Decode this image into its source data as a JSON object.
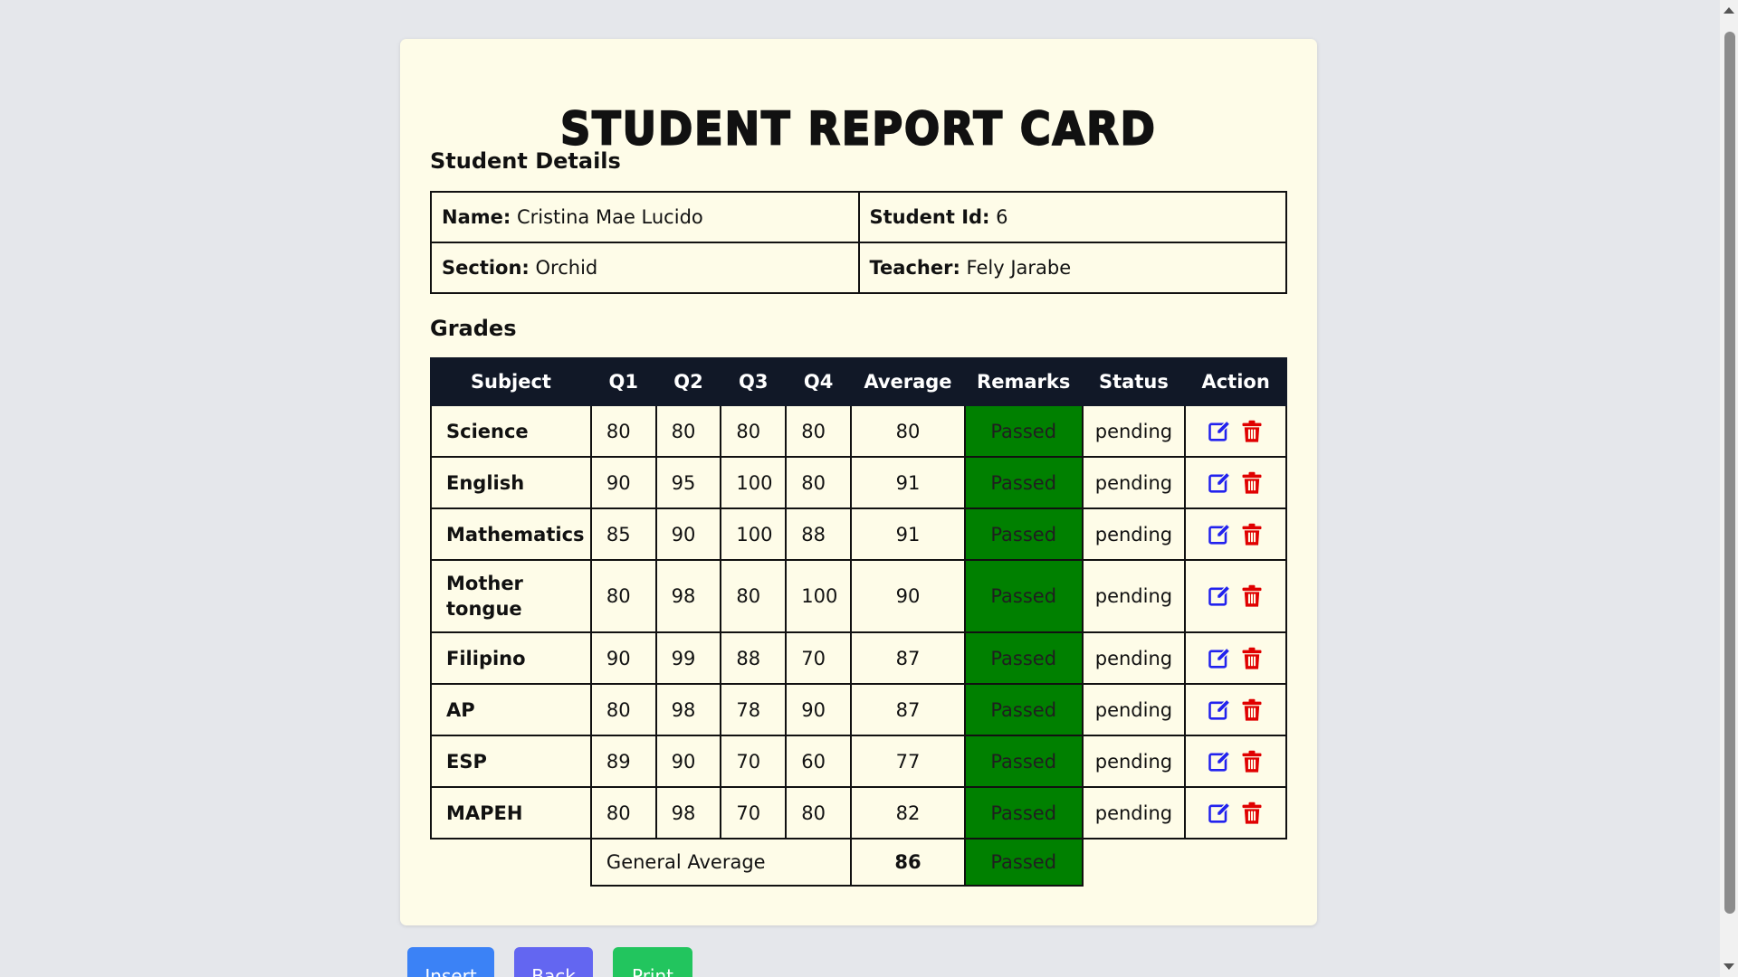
{
  "page": {
    "title": "STUDENT REPORT CARD",
    "details_heading": "Student Details",
    "grades_heading": "Grades"
  },
  "student": {
    "name_label": "Name:",
    "name": "Cristina Mae Lucido",
    "id_label": "Student Id:",
    "id": "6",
    "section_label": "Section:",
    "section": "Orchid",
    "teacher_label": "Teacher:",
    "teacher": "Fely Jarabe"
  },
  "grades": {
    "headers": [
      "Subject",
      "Q1",
      "Q2",
      "Q3",
      "Q4",
      "Average",
      "Remarks",
      "Status",
      "Action"
    ],
    "rows": [
      {
        "subject": "Science",
        "q1": "80",
        "q2": "80",
        "q3": "80",
        "q4": "80",
        "average": "80",
        "remarks": "Passed",
        "status": "pending"
      },
      {
        "subject": "English",
        "q1": "90",
        "q2": "95",
        "q3": "100",
        "q4": "80",
        "average": "91",
        "remarks": "Passed",
        "status": "pending"
      },
      {
        "subject": "Mathematics",
        "q1": "85",
        "q2": "90",
        "q3": "100",
        "q4": "88",
        "average": "91",
        "remarks": "Passed",
        "status": "pending"
      },
      {
        "subject": "Mother tongue",
        "q1": "80",
        "q2": "98",
        "q3": "80",
        "q4": "100",
        "average": "90",
        "remarks": "Passed",
        "status": "pending"
      },
      {
        "subject": "Filipino",
        "q1": "90",
        "q2": "99",
        "q3": "88",
        "q4": "70",
        "average": "87",
        "remarks": "Passed",
        "status": "pending"
      },
      {
        "subject": "AP",
        "q1": "80",
        "q2": "98",
        "q3": "78",
        "q4": "90",
        "average": "87",
        "remarks": "Passed",
        "status": "pending"
      },
      {
        "subject": "ESP",
        "q1": "89",
        "q2": "90",
        "q3": "70",
        "q4": "60",
        "average": "77",
        "remarks": "Passed",
        "status": "pending"
      },
      {
        "subject": "MAPEH",
        "q1": "80",
        "q2": "98",
        "q3": "70",
        "q4": "80",
        "average": "82",
        "remarks": "Passed",
        "status": "pending"
      }
    ],
    "general_average_label": "General Average",
    "general_average": "86",
    "general_remarks": "Passed"
  },
  "buttons": {
    "insert": "Insert",
    "back": "Back",
    "print": "Print"
  },
  "icons": {
    "edit": "edit-icon",
    "delete": "trash-icon"
  },
  "colors": {
    "page_bg": "#e5e7eb",
    "card_bg": "#fefce8",
    "header_bg": "#111827",
    "passed_bg": "#008000",
    "edit_icon": "#2222ee",
    "delete_icon": "#e00000",
    "insert_btn": "#3b82f6",
    "back_btn": "#6366f1",
    "print_btn": "#22c55e"
  }
}
